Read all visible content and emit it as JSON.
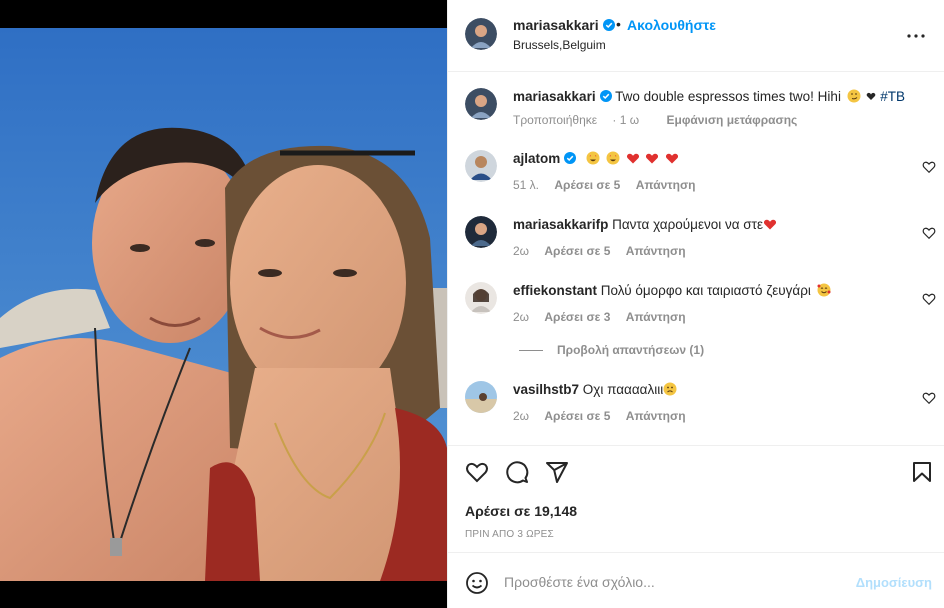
{
  "post": {
    "username": "mariasakkari",
    "follow_label": "Ακολουθήστε",
    "separator": "•",
    "location": "Brussels,Belguim"
  },
  "caption": {
    "username": "mariasakkari",
    "text": "Two double espressos times two! Hihi",
    "hashtag": "#TB",
    "edited": "Τροποποιήθηκε",
    "time": "1 ω",
    "translate": "Εμφάνιση μετάφρασης"
  },
  "comments": [
    {
      "username": "ajlatom",
      "text": "",
      "time": "51 λ.",
      "likes": "Αρέσει σε 5",
      "reply": "Απάντηση"
    },
    {
      "username": "mariasakkarifp",
      "text": "Παντα χαρούμενοι να στε",
      "time": "2ω",
      "likes": "Αρέσει σε 5",
      "reply": "Απάντηση"
    },
    {
      "username": "effiekonstant",
      "text": "Πολύ όμορφο και ταιριαστό ζευγάρι",
      "time": "2ω",
      "likes": "Αρέσει σε 3",
      "reply": "Απάντηση"
    },
    {
      "username": "vasilhstb7",
      "text": "Οχι πααααλιιι",
      "time": "2ω",
      "likes": "Αρέσει σε 5",
      "reply": "Απάντηση"
    }
  ],
  "view_replies": "Προβολή απαντήσεων (1)",
  "likes_count": "Αρέσει σε 19,148",
  "timestamp": "ΠΡΙΝ ΑΠΟ 3 ΩΡΕΣ",
  "comment_input": {
    "placeholder": "Προσθέστε ένα σχόλιο...",
    "post_label": "Δημοσίευση"
  },
  "colors": {
    "link_blue": "#0095f6",
    "post_disabled": "#b2dffc",
    "heart_red": "#ed4956",
    "text": "#262626",
    "muted": "#8e8e8e"
  },
  "icons": [
    "more-options-icon",
    "verified-badge-icon",
    "heart-icon",
    "comment-icon",
    "share-icon",
    "bookmark-icon",
    "emoji-icon"
  ]
}
